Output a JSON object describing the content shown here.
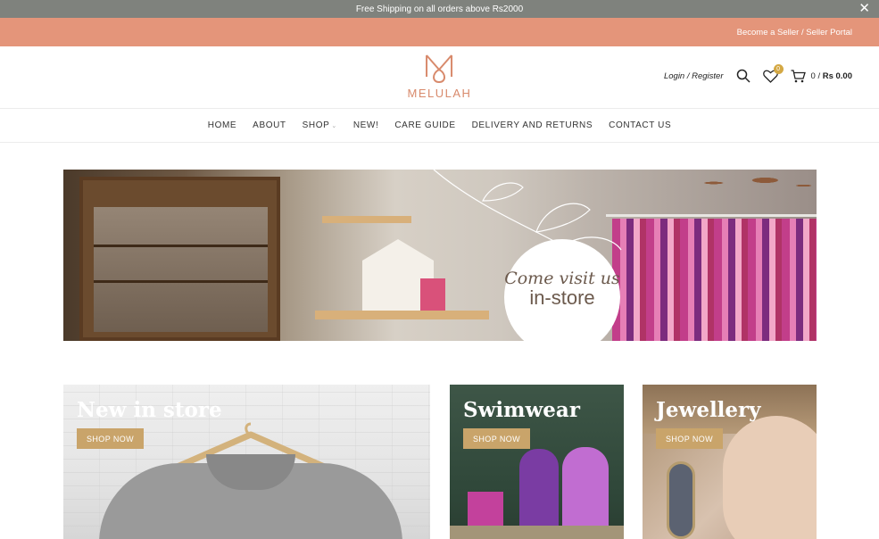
{
  "topbar": {
    "text": "Free Shipping on all orders above Rs2000",
    "close": "✕"
  },
  "sellerbar": {
    "text": "Become a Seller / Seller Portal"
  },
  "header": {
    "logo_text": "MELULAH",
    "login": "Login / Register",
    "wishlist_count": "0",
    "cart_text_prefix": "0 / ",
    "cart_total": "Rs 0.00"
  },
  "nav": {
    "items": [
      "HOME",
      "ABOUT",
      "SHOP",
      "NEW!",
      "CARE GUIDE",
      "DELIVERY AND RETURNS",
      "CONTACT US"
    ]
  },
  "banner": {
    "line1": "Come visit us",
    "line2": "in-store"
  },
  "cards": [
    {
      "title": "New in store",
      "button": "SHOP NOW"
    },
    {
      "title": "Swimwear",
      "button": "SHOP NOW"
    },
    {
      "title": "Jewellery",
      "button": "SHOP NOW"
    }
  ],
  "colors": {
    "topbar": "#7f827d",
    "sellerbar": "#e4957a",
    "accent": "#d88a6c",
    "button": "#c9a46a"
  }
}
